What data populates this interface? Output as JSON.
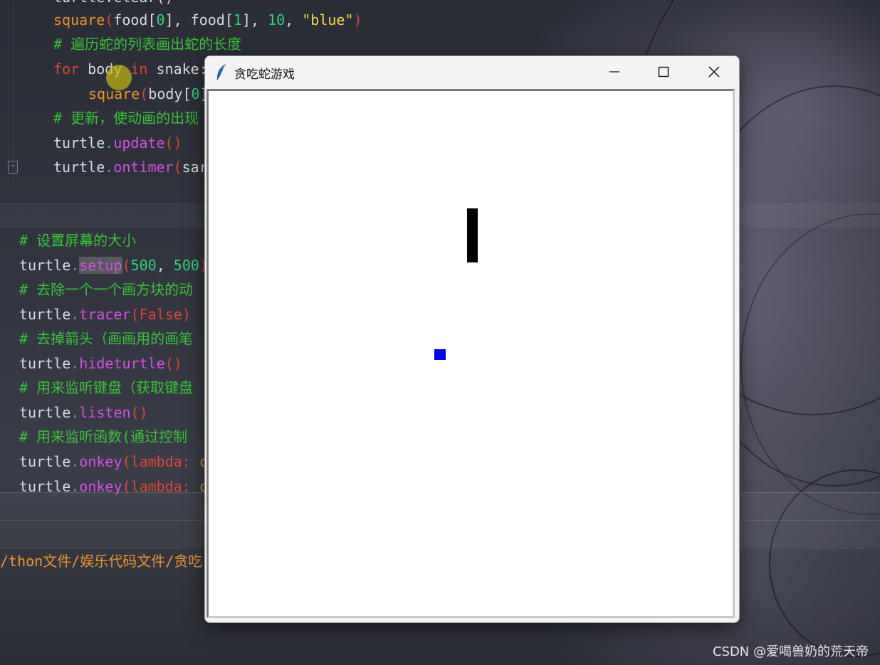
{
  "editor": {
    "code_top": [
      [
        {
          "t": "turtle.clear()",
          "c": "c-plain"
        }
      ],
      [
        {
          "t": "square",
          "c": "c-fn"
        },
        {
          "t": "(",
          "c": "c-paren"
        },
        {
          "t": "food[",
          "c": "c-plain"
        },
        {
          "t": "0",
          "c": "c-num"
        },
        {
          "t": "], food[",
          "c": "c-plain"
        },
        {
          "t": "1",
          "c": "c-num"
        },
        {
          "t": "], ",
          "c": "c-plain"
        },
        {
          "t": "10",
          "c": "c-num"
        },
        {
          "t": ", ",
          "c": "c-plain"
        },
        {
          "t": "\"blue\"",
          "c": "c-str"
        },
        {
          "t": ")",
          "c": "c-paren"
        }
      ],
      [
        {
          "t": "# 遍历蛇的列表画出蛇的长度",
          "c": "c-comment"
        }
      ],
      [
        {
          "t": "for",
          "c": "c-kw"
        },
        {
          "t": " body ",
          "c": "c-plain"
        },
        {
          "t": "in",
          "c": "c-kw"
        },
        {
          "t": " snake:",
          "c": "c-plain"
        }
      ],
      [
        {
          "t": "square",
          "c": "c-fn"
        },
        {
          "t": "(",
          "c": "c-paren"
        },
        {
          "t": "body[",
          "c": "c-plain"
        },
        {
          "t": "0",
          "c": "c-num"
        },
        {
          "t": "]",
          "c": "c-plain"
        }
      ],
      [
        {
          "t": "# 更新，使动画的出现",
          "c": "c-comment"
        }
      ],
      [
        {
          "t": "turtle",
          "c": "c-plain"
        },
        {
          "t": ".",
          "c": "c-dot"
        },
        {
          "t": "update",
          "c": "c-meth"
        },
        {
          "t": "()",
          "c": "c-paren"
        }
      ],
      [
        {
          "t": "turtle",
          "c": "c-plain"
        },
        {
          "t": ".",
          "c": "c-dot"
        },
        {
          "t": "ontimer",
          "c": "c-meth"
        },
        {
          "t": "(",
          "c": "c-paren"
        },
        {
          "t": "sar",
          "c": "c-plain"
        }
      ]
    ],
    "code_bottom": [
      [
        {
          "t": "# 设置屏幕的大小",
          "c": "c-comment"
        }
      ],
      [
        {
          "t": "turtle",
          "c": "c-plain"
        },
        {
          "t": ".",
          "c": "c-dot"
        },
        {
          "t": "setup",
          "c": "c-meth hl-word"
        },
        {
          "t": "(",
          "c": "c-paren"
        },
        {
          "t": "500",
          "c": "c-num"
        },
        {
          "t": ", ",
          "c": "c-plain"
        },
        {
          "t": "500",
          "c": "c-num"
        },
        {
          "t": ")",
          "c": "c-paren"
        }
      ],
      [
        {
          "t": "# 去除一个一个画方块的动",
          "c": "c-comment"
        }
      ],
      [
        {
          "t": "turtle",
          "c": "c-plain"
        },
        {
          "t": ".",
          "c": "c-dot"
        },
        {
          "t": "tracer",
          "c": "c-meth"
        },
        {
          "t": "(",
          "c": "c-paren"
        },
        {
          "t": "False",
          "c": "c-kw"
        },
        {
          "t": ")",
          "c": "c-paren"
        }
      ],
      [
        {
          "t": "# 去掉箭头（画画用的画笔",
          "c": "c-comment"
        }
      ],
      [
        {
          "t": "turtle",
          "c": "c-plain"
        },
        {
          "t": ".",
          "c": "c-dot"
        },
        {
          "t": "hideturtle",
          "c": "c-meth"
        },
        {
          "t": "()",
          "c": "c-paren"
        }
      ],
      [
        {
          "t": "# 用来监听键盘（获取键盘",
          "c": "c-comment"
        }
      ],
      [
        {
          "t": "turtle",
          "c": "c-plain"
        },
        {
          "t": ".",
          "c": "c-dot"
        },
        {
          "t": "listen",
          "c": "c-meth"
        },
        {
          "t": "()",
          "c": "c-paren"
        }
      ],
      [
        {
          "t": "# 用来监听函数(通过控制",
          "c": "c-comment"
        }
      ],
      [
        {
          "t": "turtle",
          "c": "c-plain"
        },
        {
          "t": ".",
          "c": "c-dot"
        },
        {
          "t": "onkey",
          "c": "c-meth"
        },
        {
          "t": "(",
          "c": "c-paren"
        },
        {
          "t": "lambda: ",
          "c": "c-kw"
        },
        {
          "t": "c",
          "c": "c-fn"
        }
      ],
      [
        {
          "t": "turtle",
          "c": "c-plain"
        },
        {
          "t": ".",
          "c": "c-dot"
        },
        {
          "t": "onkey",
          "c": "c-meth"
        },
        {
          "t": "(",
          "c": "c-paren"
        },
        {
          "t": "lambda: ",
          "c": "c-kw"
        },
        {
          "t": "c",
          "c": "c-fn"
        }
      ]
    ],
    "run_path": "/thon文件/娱乐代码文件/贪吃"
  },
  "watermark": "CSDN @爱喝兽奶的荒天帝",
  "window": {
    "title": "贪吃蛇游戏",
    "minimize_label": "—",
    "maximize_label": "☐",
    "close_label": "✕",
    "app_icon": "feather-icon"
  },
  "game": {
    "snake_color": "#000000",
    "food_color": "#0000ff",
    "snake": [
      [
        0,
        120
      ],
      [
        0,
        110
      ],
      [
        0,
        100
      ],
      [
        0,
        90
      ],
      [
        0,
        80
      ]
    ],
    "food": [
      -30,
      -10
    ],
    "cell_size": 10
  }
}
